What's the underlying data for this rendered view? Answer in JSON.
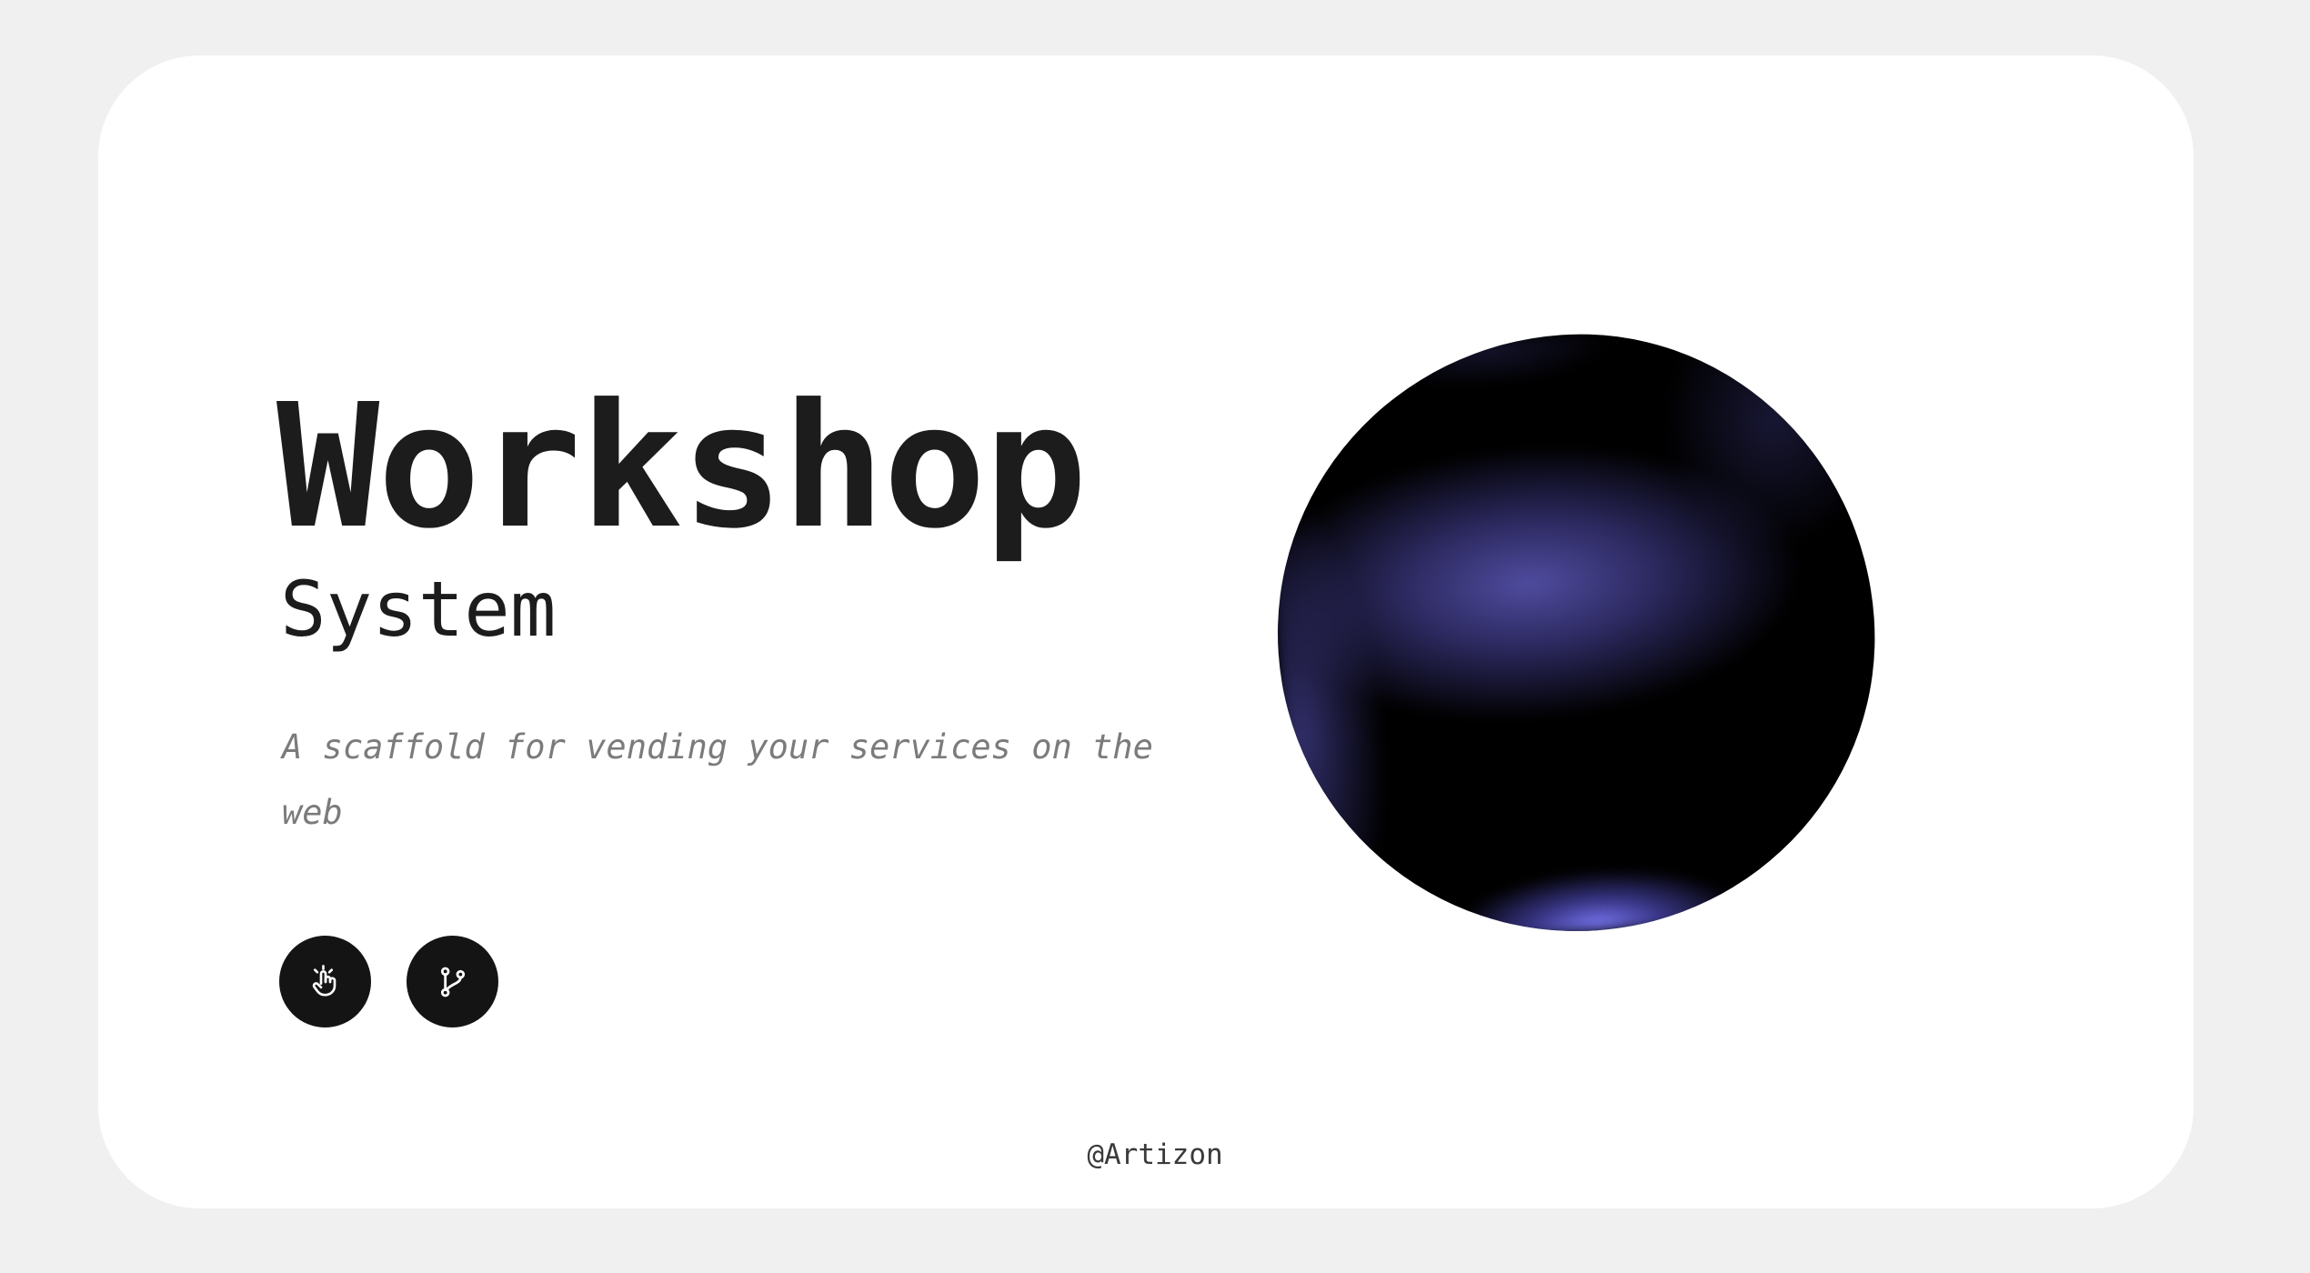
{
  "hero": {
    "title": "Workshop",
    "subtitle": "System",
    "tagline": "A scaffold for vending your services on the web"
  },
  "actions": [
    {
      "icon": "hand-tap-icon"
    },
    {
      "icon": "git-branch-icon"
    }
  ],
  "footer": {
    "credit": "@Artizon"
  },
  "colors": {
    "page_background": "#f0f0f0",
    "card_background": "#ffffff",
    "text_primary": "#1c1c1c",
    "text_muted": "#7b7b7b",
    "button_background": "#141414",
    "orb_base": "#000000",
    "orb_glow": "#5450a8",
    "orb_highlight": "#7876f0"
  }
}
